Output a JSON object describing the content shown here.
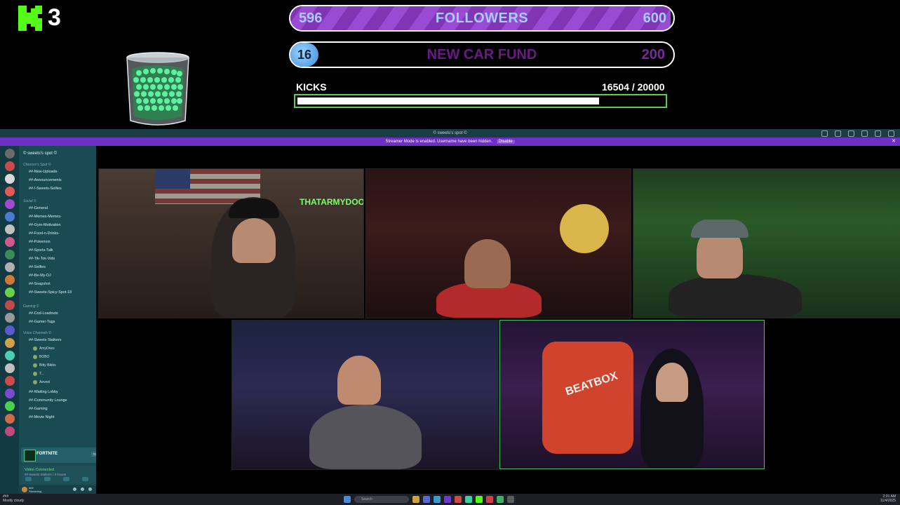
{
  "overlay": {
    "kick_count": "3",
    "followers": {
      "current": "596",
      "label": "FOLLOWERS",
      "goal": "600",
      "progress": 0.993
    },
    "car_fund": {
      "current": "16",
      "label": "NEW CAR FUND",
      "goal": "200",
      "progress": 0.08
    },
    "kicks": {
      "label": "KICKS",
      "value": "16504  / 20000",
      "progress": 0.825
    }
  },
  "window": {
    "title": "© sweets's spot © ",
    "notice": "Streamer Mode is enabled. Username have been hidden.",
    "notice_button": "Disable"
  },
  "server": {
    "name": "© sweets's spot ©",
    "categories": [
      {
        "label": "Chexxxx's Spot ©",
        "channels": [
          "##-New-Uploads-",
          "##-Announcements",
          "##-!-Sweets-Selfies"
        ]
      },
      {
        "label": "Social ©",
        "channels": [
          "##-General",
          "##-Memes-Memes-",
          "##-Gym-Motivation",
          "##-Food-n-Drinks-",
          "##-Pokemon",
          "##-Sports-Talk",
          "##-Tik-Tok-Vids",
          "##-Selfies",
          "##-Be-My-DJ",
          "##-Snapshot",
          "##-Sweets-Spicy-Spot-18"
        ]
      },
      {
        "label": "Gaming ©",
        "channels": [
          "##-Cod-Loadouts",
          "##-Gamer-Tags"
        ]
      },
      {
        "label": "Voice Channels ©",
        "channels": [
          "##-Sweets Stalkers",
          "##-Waiting Lobby",
          "##-Community Lounge",
          "##-Gaming",
          "##-Movie Night"
        ]
      }
    ],
    "voice_users": [
      "AmyDoes",
      "BOBO",
      "Bitty Bibbs",
      "T...",
      "Aeveel"
    ]
  },
  "activity": {
    "game": "FORTNITE",
    "button": "Get Invite"
  },
  "voice_status": {
    "title": "Video Connected",
    "channel": "##-Sweets Stalkers / S-house"
  },
  "user_panel": {
    "name": "###",
    "status": "Streaming"
  },
  "tiles": [
    {
      "name": "tile-1",
      "label": "THATARMYDOOD"
    },
    {
      "name": "tile-2",
      "label": ""
    },
    {
      "name": "tile-3",
      "label": ""
    },
    {
      "name": "tile-4",
      "label": ""
    },
    {
      "name": "tile-5",
      "label": "BEATBOX"
    }
  ],
  "taskbar": {
    "left_line1": "###",
    "left_line2": "Mostly cloudy",
    "search_placeholder": "Search",
    "time": "2:01 AM",
    "date": "11/4/2025"
  },
  "colors": {
    "follower_fill": "#9a4bd3",
    "kicks_border": "#53d24a",
    "notice_bar": "#6e2fc4",
    "sidebar": "#1a4a52"
  }
}
